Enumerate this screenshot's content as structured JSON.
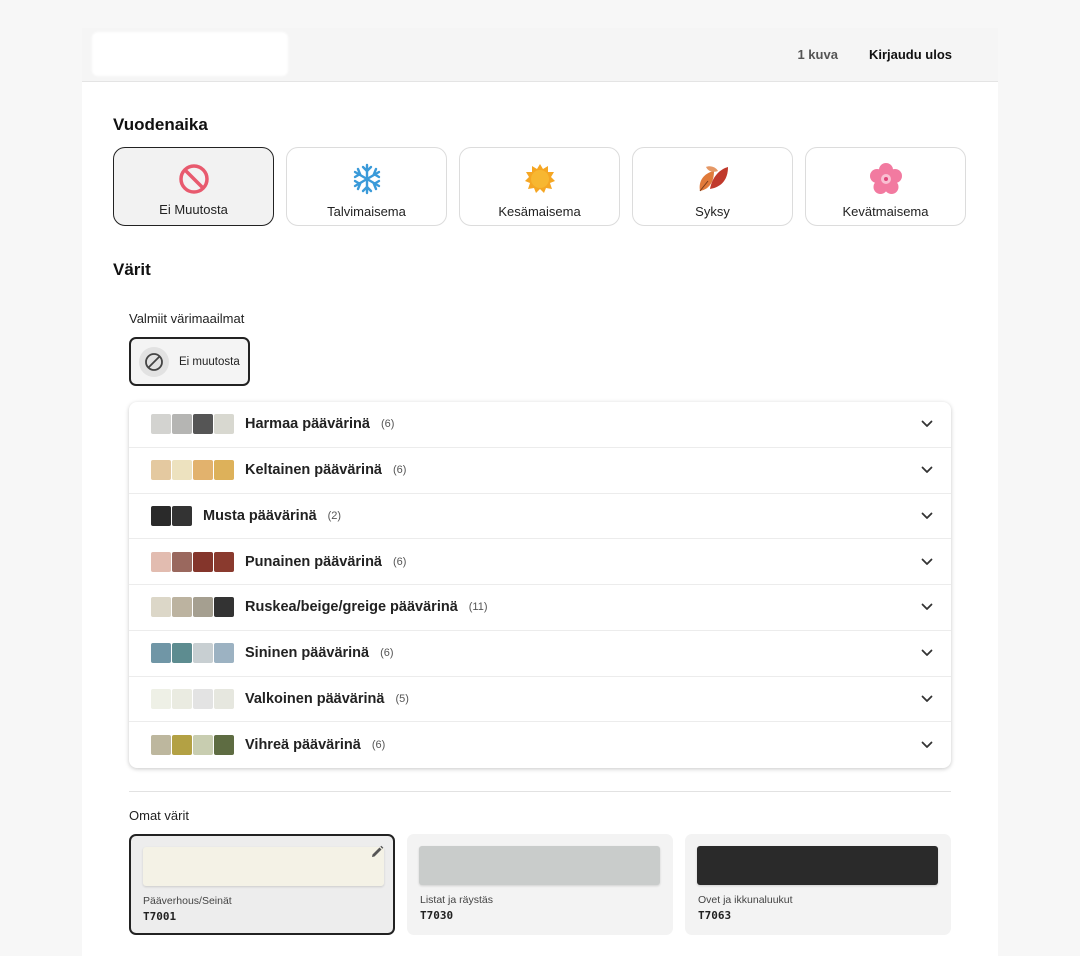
{
  "header": {
    "image_count": "1 kuva",
    "logout": "Kirjaudu ulos"
  },
  "seasons": {
    "title": "Vuodenaika",
    "options": [
      {
        "label": "Ei Muutosta",
        "icon": "no-change-icon",
        "selected": true
      },
      {
        "label": "Talvimaisema",
        "icon": "snowflake-icon",
        "selected": false
      },
      {
        "label": "Kesämaisema",
        "icon": "sun-icon",
        "selected": false
      },
      {
        "label": "Syksy",
        "icon": "autumn-leaf-icon",
        "selected": false
      },
      {
        "label": "Kevätmaisema",
        "icon": "blossom-icon",
        "selected": false
      }
    ]
  },
  "colors": {
    "title": "Värit",
    "presets_label": "Valmiit värimaailmat",
    "preset_none": "Ei muutosta",
    "groups": [
      {
        "name": "Harmaa päävärinä",
        "count": "(6)",
        "swatches": [
          "#d3d3d0",
          "#b5b5b3",
          "#555555",
          "#d8d8d0"
        ]
      },
      {
        "name": "Keltainen päävärinä",
        "count": "(6)",
        "swatches": [
          "#e4c9a0",
          "#ede2bf",
          "#e2b26d",
          "#ddb15a"
        ]
      },
      {
        "name": "Musta päävärinä",
        "count": "(2)",
        "swatches": [
          "#2a2a2a",
          "#333333"
        ]
      },
      {
        "name": "Punainen päävärinä",
        "count": "(6)",
        "swatches": [
          "#e2bcb0",
          "#9a685e",
          "#84352b",
          "#8a3a2e"
        ]
      },
      {
        "name": "Ruskea/beige/greige päävärinä",
        "count": "(11)",
        "swatches": [
          "#dcd7c8",
          "#bcb3a0",
          "#a59f90",
          "#333333"
        ]
      },
      {
        "name": "Sininen päävärinä",
        "count": "(6)",
        "swatches": [
          "#7096a6",
          "#5d8c90",
          "#c8cfd2",
          "#9cb2c2"
        ]
      },
      {
        "name": "Valkoinen päävärinä",
        "count": "(5)",
        "swatches": [
          "#eef0e6",
          "#eaebe1",
          "#e3e3e3",
          "#e6e7df"
        ]
      },
      {
        "name": "Vihreä päävärinä",
        "count": "(6)",
        "swatches": [
          "#bdb79e",
          "#b3a144",
          "#c8cdb0",
          "#5e6c42"
        ]
      }
    ],
    "custom_label": "Omat värit",
    "custom": [
      {
        "name": "Pääverhous/Seinät",
        "code": "T7001",
        "color": "#f4f2e6",
        "selected": true
      },
      {
        "name": "Listat ja räystäs",
        "code": "T7030",
        "color": "#c9cccb",
        "selected": false
      },
      {
        "name": "Ovet ja ikkunaluukut",
        "code": "T7063",
        "color": "#2a2a2a",
        "selected": false
      }
    ]
  }
}
